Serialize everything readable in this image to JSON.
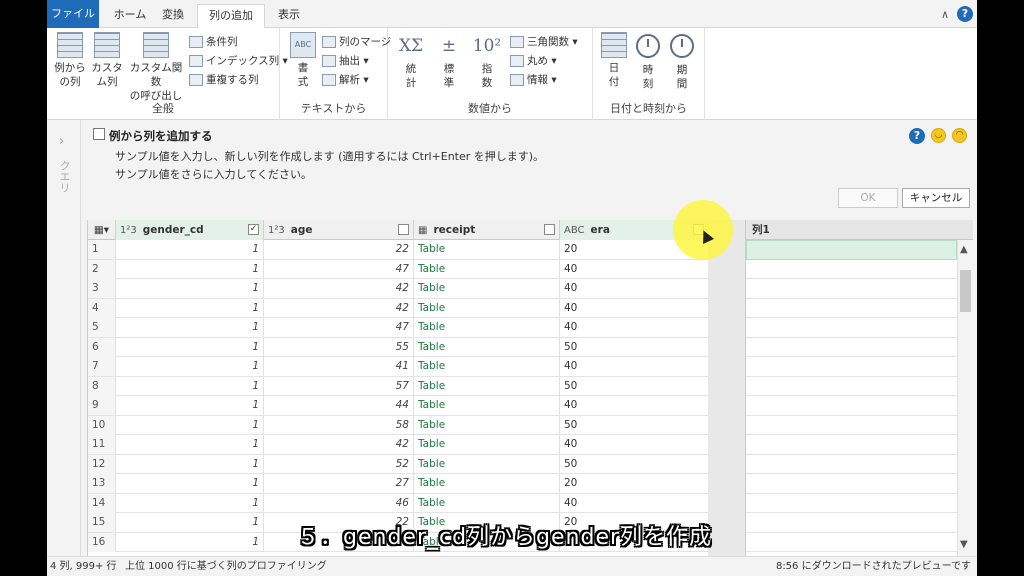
{
  "tabs": {
    "file": "ファイル",
    "home": "ホーム",
    "transform": "変換",
    "add_column": "列の追加",
    "view": "表示"
  },
  "ribbon": {
    "general": {
      "label": "全般",
      "column_from_examples": "例から\nの列",
      "custom_column": "カスタ\nム列",
      "invoke_custom_function": "カスタム関数\nの呼び出し",
      "conditional_column": "条件列",
      "index_column": "インデックス列",
      "duplicate_column": "重複する列"
    },
    "from_text": {
      "label": "テキストから",
      "format": "書\n式",
      "merge_columns": "列のマージ",
      "extract": "抽出",
      "parse": "解析"
    },
    "from_number": {
      "label": "数値から",
      "statistics": "統\n計",
      "standard": "標\n準",
      "scientific": "指\n数",
      "trigonometry": "三角関数",
      "rounding": "丸め",
      "information": "情報"
    },
    "from_date_time": {
      "label": "日付と時刻から",
      "date": "日\n付",
      "time": "時\n刻",
      "duration": "期\n間"
    }
  },
  "rail": {
    "label": "クエリ"
  },
  "panel": {
    "title": "例から列を追加する",
    "line1": "サンプル値を入力し、新しい列を作成します (適用するには Ctrl+Enter を押します)。",
    "line2": "サンプル値をさらに入力してください。",
    "ok": "OK",
    "cancel": "キャンセル"
  },
  "grid": {
    "columns": [
      {
        "type": "1²3",
        "name": "gender_cd",
        "checked": true
      },
      {
        "type": "1²3",
        "name": "age",
        "checked": false
      },
      {
        "type": "▦",
        "name": "receipt",
        "checked": false
      },
      {
        "type": "ABC",
        "name": "era",
        "checked": false
      }
    ],
    "rows": [
      [
        "1",
        "1",
        "22",
        "Table",
        "20"
      ],
      [
        "2",
        "1",
        "47",
        "Table",
        "40"
      ],
      [
        "3",
        "1",
        "42",
        "Table",
        "40"
      ],
      [
        "4",
        "1",
        "42",
        "Table",
        "40"
      ],
      [
        "5",
        "1",
        "47",
        "Table",
        "40"
      ],
      [
        "6",
        "1",
        "55",
        "Table",
        "50"
      ],
      [
        "7",
        "1",
        "41",
        "Table",
        "40"
      ],
      [
        "8",
        "1",
        "57",
        "Table",
        "50"
      ],
      [
        "9",
        "1",
        "44",
        "Table",
        "40"
      ],
      [
        "10",
        "1",
        "58",
        "Table",
        "50"
      ],
      [
        "11",
        "1",
        "42",
        "Table",
        "40"
      ],
      [
        "12",
        "1",
        "52",
        "Table",
        "50"
      ],
      [
        "13",
        "1",
        "27",
        "Table",
        "20"
      ],
      [
        "14",
        "1",
        "46",
        "Table",
        "40"
      ],
      [
        "15",
        "1",
        "22",
        "Table",
        "20"
      ],
      [
        "16",
        "1",
        "",
        "Table",
        ""
      ]
    ]
  },
  "new_column": {
    "header": "列1"
  },
  "status": {
    "columns_rows": "4 列, 999+ 行",
    "profiling": "上位 1000 行に基づく列のプロファイリング",
    "preview": "8:56 にダウンロードされたプレビューです"
  },
  "caption": "５．gender_cd列からgender列を作成",
  "colors": {
    "file_tab": "#1d6bb9",
    "table_text": "#1a7a3c",
    "highlight": "#fff53c"
  }
}
